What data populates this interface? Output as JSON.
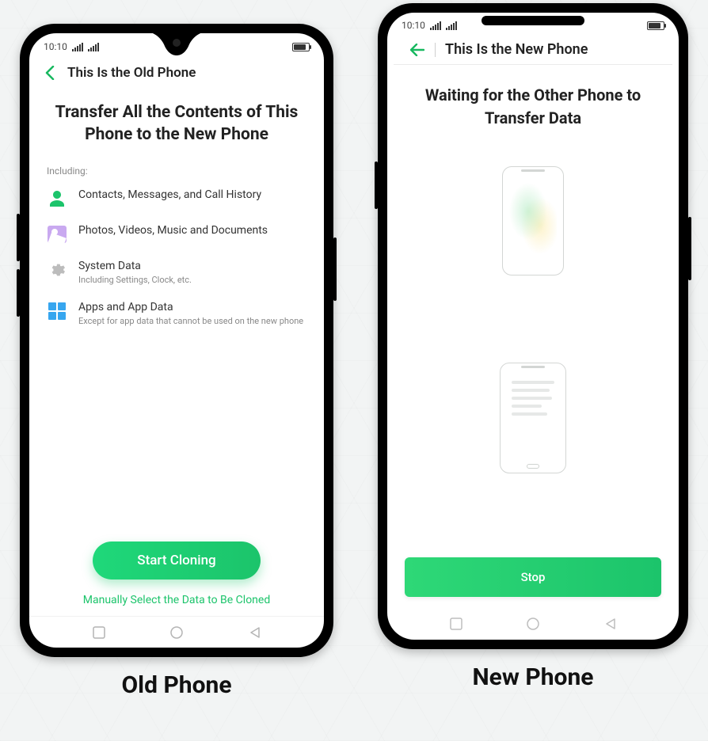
{
  "global": {
    "time": "10:10"
  },
  "old": {
    "caption": "Old Phone",
    "appbar_title": "This Is the Old Phone",
    "title": "Transfer All the Contents of This Phone to the New Phone",
    "including_label": "Including:",
    "items": [
      {
        "icon": "contacts-icon",
        "line1": "Contacts, Messages, and Call History",
        "line2": ""
      },
      {
        "icon": "media-icon",
        "line1": "Photos, Videos, Music and Documents",
        "line2": ""
      },
      {
        "icon": "gear-icon",
        "line1": "System Data",
        "line2": "Including Settings, Clock, etc."
      },
      {
        "icon": "apps-icon",
        "line1": "Apps and App Data",
        "line2": "Except for app data that cannot be used on the new phone"
      }
    ],
    "primary_button": "Start Cloning",
    "secondary_link": "Manually Select the Data to Be Cloned"
  },
  "new": {
    "caption": "New Phone",
    "appbar_title": "This Is the New Phone",
    "title": "Waiting for the Other Phone to Transfer Data",
    "primary_button": "Stop"
  },
  "colors": {
    "accent": "#1cc46b"
  }
}
